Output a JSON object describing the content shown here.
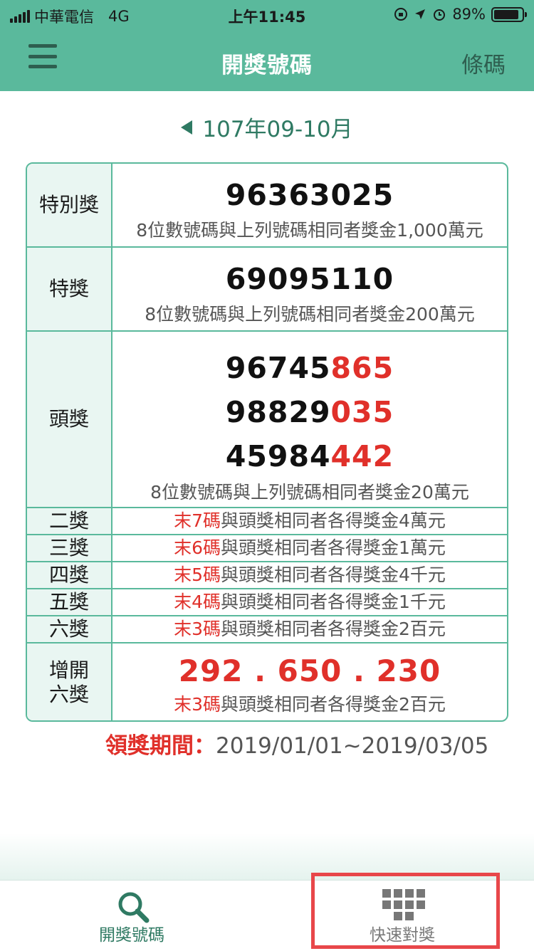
{
  "status_bar": {
    "carrier": "中華電信",
    "network": "4G",
    "time": "上午11:45",
    "battery": "89%",
    "battery_level": 0.89
  },
  "nav": {
    "title": "開獎號碼",
    "right_label": "條碼"
  },
  "period": "107年09-10月",
  "prizes": {
    "special": {
      "label": "特別獎",
      "number": "96363025",
      "desc": "8位數號碼與上列號碼相同者獎金1,000萬元"
    },
    "grand": {
      "label": "特獎",
      "number": "69095110",
      "desc": "8位數號碼與上列號碼相同者獎金200萬元"
    },
    "first": {
      "label": "頭獎",
      "numbers": [
        {
          "head": "96745",
          "tail": "865"
        },
        {
          "head": "98829",
          "tail": "035"
        },
        {
          "head": "45984",
          "tail": "442"
        }
      ],
      "desc": "8位數號碼與上列號碼相同者獎金20萬元"
    },
    "lower": [
      {
        "label": "二獎",
        "code": "末7碼",
        "text": "與頭獎相同者各得獎金4萬元"
      },
      {
        "label": "三獎",
        "code": "末6碼",
        "text": "與頭獎相同者各得獎金1萬元"
      },
      {
        "label": "四獎",
        "code": "末5碼",
        "text": "與頭獎相同者各得獎金4千元"
      },
      {
        "label": "五獎",
        "code": "末4碼",
        "text": "與頭獎相同者各得獎金1千元"
      },
      {
        "label": "六獎",
        "code": "末3碼",
        "text": "與頭獎相同者各得獎金2百元"
      }
    ],
    "extra_sixth": {
      "label_line1": "增開",
      "label_line2": "六獎",
      "numbers": "292 . 650 . 230",
      "code": "末3碼",
      "text": "與頭獎相同者各得獎金2百元"
    }
  },
  "claim": {
    "label": "領獎期間：",
    "range": "2019/01/01~2019/03/05"
  },
  "tabs": [
    {
      "label": "開獎號碼",
      "icon": "search-icon"
    },
    {
      "label": "快速對獎",
      "icon": "grid-icon"
    }
  ],
  "colors": {
    "primary": "#5ab99c",
    "accent_red": "#e0302a",
    "highlight_box": "#e8474a"
  }
}
